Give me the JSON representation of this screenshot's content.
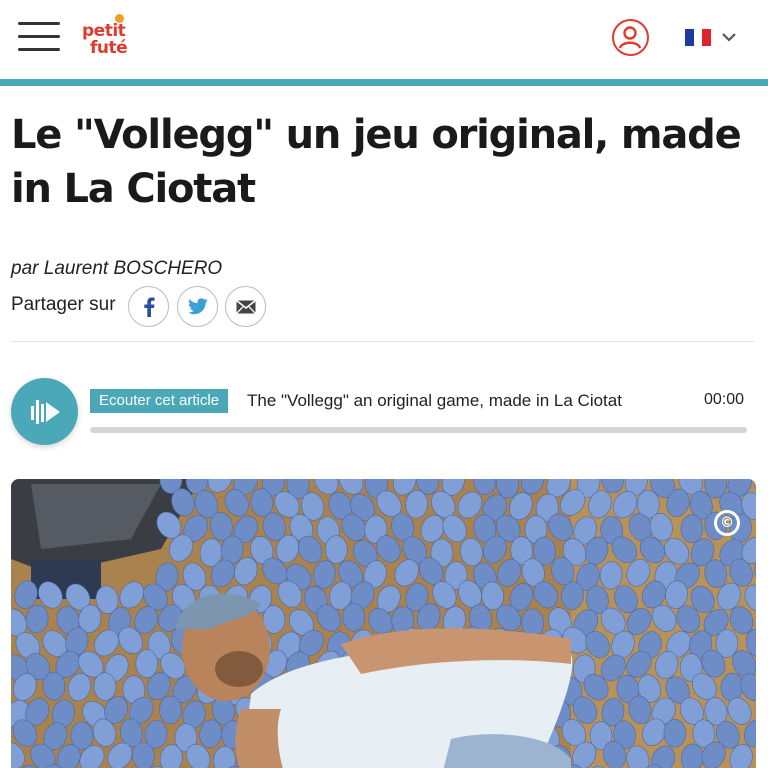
{
  "header": {
    "logo_line1": "petit",
    "logo_line2": "futé",
    "menu_icon": "hamburger-menu-icon",
    "account_icon": "user-account-icon",
    "language_icon": "french-flag-icon",
    "dropdown_icon": "chevron-down-icon"
  },
  "article": {
    "title": "Le \"Vollegg\" un jeu original, made in La Ciotat",
    "byline_prefix": "par",
    "author": "Laurent BOSCHERO",
    "share_label": "Partager sur",
    "share_icons": [
      "facebook-icon",
      "twitter-icon",
      "email-icon"
    ]
  },
  "audio": {
    "badge": "Ecouter cet article",
    "title": "The \"Vollegg\" an original game, made in La Ciotat",
    "time": "00:00",
    "progress": 0
  },
  "photo": {
    "copyright": "©"
  },
  "colors": {
    "accent": "#4aa8b8",
    "brand_red": "#e03a2f",
    "text": "#1a1a1a",
    "egg_blue": "#7f9fd6"
  }
}
